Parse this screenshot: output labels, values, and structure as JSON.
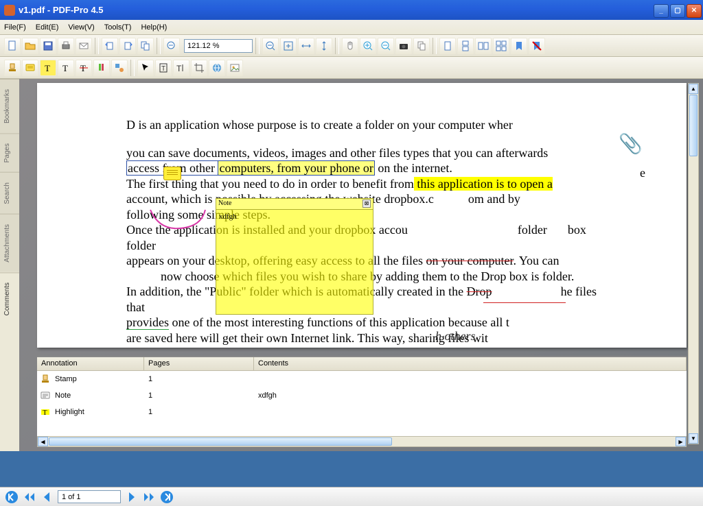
{
  "title": "v1.pdf - PDF-Pro 4.5",
  "menu": {
    "file": "File(F)",
    "edit": "Edit(E)",
    "view": "View(V)",
    "tools": "Tools(T)",
    "help": "Help(H)"
  },
  "zoom": "121.12 %",
  "sidetabs": {
    "bookmarks": "Bookmarks",
    "pages": "Pages",
    "search": "Search",
    "attachments": "Attachments",
    "comments": "Comments"
  },
  "doc": {
    "p1": "D is an application whose purpose is to create a folder on your computer wher",
    "e": "e",
    "p2a": "you can save documents, videos, images and other files types that you can afterwards",
    "p3a": "access from other ",
    "p3b": "computers, from your phone or",
    "p3c": " on the internet.",
    "p4a": "The first thing that you need to do in order to benefit from",
    "p4b": " this application is to open a",
    "p5a": " account, which is possible by accessing the website dropbox.c",
    "p5b": "om and by",
    "p6": "following some simple steps.",
    "p7a": "Once the application is installed and your dropbox accou",
    "p7b": "folder",
    "p7c": "box folder",
    "p8a": "appears on your desktop, offering easy access to all the files ",
    "p8b": "on your computer",
    "p8c": ". You can",
    "p9": "now choose which files you wish to share by adding them to the Drop box is folder.",
    "p10a": "In addition, the \"Public\" folder which is automatically created in the ",
    "p10b": "Drop",
    "p10c": "he files that",
    "p11a": "provides",
    "p11b": " one of the most interesting functions of this application because all t",
    "p12a": "are saved here will get their own Internet link. This way, sharing files wit",
    "p12b": "h others"
  },
  "note": {
    "title": "Note",
    "body": "xdfgh"
  },
  "anno": {
    "hdr_annotation": "Annotation",
    "hdr_pages": "Pages",
    "hdr_contents": "Contents",
    "rows": [
      {
        "type": "Stamp",
        "page": "1",
        "content": ""
      },
      {
        "type": "Note",
        "page": "1",
        "content": "xdfgh"
      },
      {
        "type": "Highlight",
        "page": "1",
        "content": ""
      }
    ]
  },
  "nav": {
    "page": "1 of 1"
  }
}
